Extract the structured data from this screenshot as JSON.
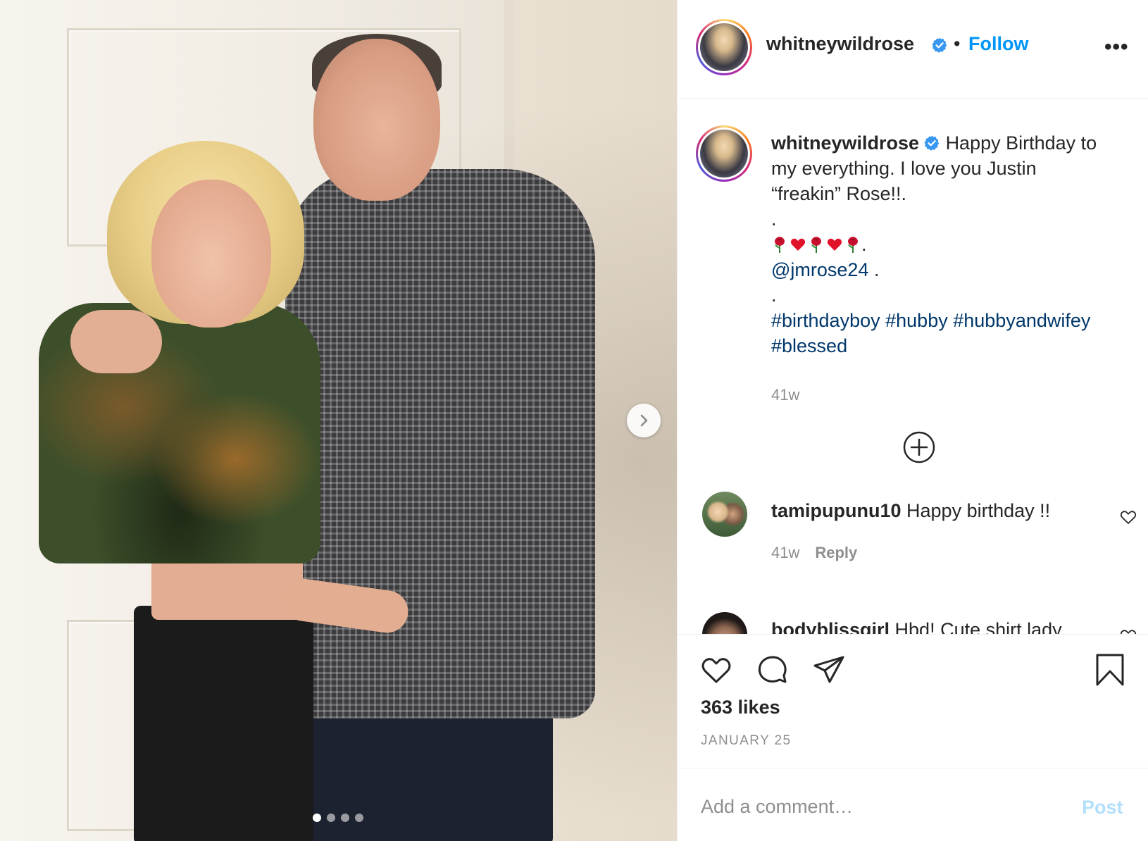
{
  "post": {
    "author": "whitneywildrose",
    "follow_label": "Follow",
    "separator": "•",
    "more_label": "•••",
    "carousel_total": 4,
    "carousel_active": 1
  },
  "caption": {
    "username": "whitneywildrose",
    "line1": "Happy Birthday to",
    "line2": "my everything. I love you Justin",
    "line3": "“freakin” Rose!!.",
    "dot1": ".",
    "emoji_suffix": ".",
    "mention": "@jmrose24",
    "mention_suffix": " .",
    "dot2": ".",
    "hashtags_line1": [
      "#birthdayboy",
      "#hubby",
      "#hubbyandwifey"
    ],
    "hashtags_line2": [
      "#blessed"
    ],
    "time": "41w"
  },
  "comments": [
    {
      "username": "tamipupunu10",
      "text": "Happy birthday !!",
      "time": "41w",
      "reply_label": "Reply"
    },
    {
      "username": "bodyblissgirl",
      "text": "Hbd! Cute shirt lady"
    }
  ],
  "footer": {
    "likes": "363 likes",
    "date": "JANUARY 25",
    "comment_placeholder": "Add a comment…",
    "post_label": "Post"
  },
  "colors": {
    "accent": "#0095f6",
    "link": "#00376b",
    "muted": "#8e8e8e",
    "post_disabled": "#b2dffc"
  }
}
